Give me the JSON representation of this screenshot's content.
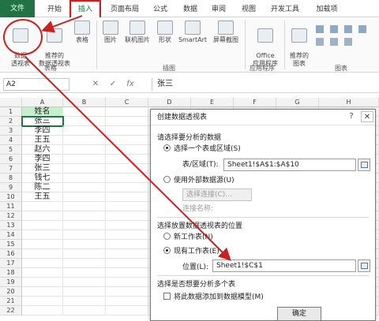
{
  "tabs": [
    "文件",
    "开始",
    "插入",
    "页面布局",
    "公式",
    "数据",
    "审阅",
    "视图",
    "开发工具",
    "加载项"
  ],
  "ribbon": {
    "pivot_label": "数据\n透视表",
    "recommended_pivot_label": "推荐的\n数据透视表",
    "table_label": "表格",
    "tables_group": "表格",
    "picture_label": "图片",
    "online_picture_label": "联机图片",
    "shapes_label": "形状",
    "smartart_label": "SmartArt",
    "screenshot_label": "屏幕截图",
    "illustrations_group": "插图",
    "office_apps_label": "Office\n应用程序",
    "apps_group": "应用程序",
    "recommended_chart_label": "推荐的\n图表",
    "charts_group": "图表"
  },
  "formula_bar": {
    "name_box": "A2",
    "cancel": "✕",
    "enter": "✓",
    "fx": "fx",
    "value": "张三"
  },
  "columns": [
    "A",
    "B",
    "C",
    "D",
    "E",
    "F",
    "G",
    "H"
  ],
  "rows": [
    "1",
    "2",
    "3",
    "4",
    "5",
    "6",
    "7",
    "8",
    "9",
    "10",
    "11",
    "12",
    "13",
    "14",
    "15",
    "16",
    "17",
    "18",
    "19",
    "20",
    "21",
    "22"
  ],
  "cells_a": [
    "姓名",
    "张三",
    "李四",
    "王五",
    "赵六",
    "李四",
    "张三",
    "钱七",
    "陈二",
    "王五"
  ],
  "dialog": {
    "title": "创建数据透视表",
    "help": "?",
    "close": "✕",
    "section_data": "请选择要分析的数据",
    "opt_table": "选择一个表或区域(S)",
    "range_label": "表/区域(T):",
    "range_value": "Sheet1!$A$1:$A$10",
    "opt_external": "使用外部数据源(U)",
    "choose_conn": "选择连接(C)...",
    "conn_name": "连接名称:",
    "section_location": "选择放置数据透视表的位置",
    "opt_new_sheet": "新工作表(N)",
    "opt_existing": "现有工作表(E)",
    "location_label": "位置(L):",
    "location_value": "Sheet1!$C$1",
    "section_multi": "选择是否想要分析多个表",
    "add_model": "将此数据添加到数据模型(M)",
    "ok": "确定"
  },
  "colors": {
    "excel_green": "#217346",
    "highlight_red": "#cc1f1f",
    "header_fill": "#c6efce"
  }
}
